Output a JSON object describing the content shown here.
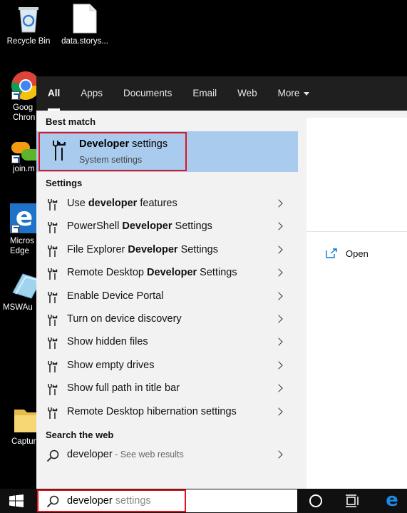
{
  "desktop": {
    "icons": [
      {
        "label": "Recycle Bin",
        "icon": "recycle-bin-icon"
      },
      {
        "label": "data.storys...",
        "icon": "file-icon"
      },
      {
        "label": "Goog Chron",
        "icon": "chrome-icon"
      },
      {
        "label": "join.m",
        "icon": "join-me-icon"
      },
      {
        "label": "Micros Edge",
        "icon": "edge-icon"
      },
      {
        "label": "MSWAu",
        "icon": "mswau-icon"
      },
      {
        "label": "Captur",
        "icon": "folder-icon"
      }
    ]
  },
  "tabs": [
    {
      "label": "All",
      "active": true
    },
    {
      "label": "Apps"
    },
    {
      "label": "Documents"
    },
    {
      "label": "Email"
    },
    {
      "label": "Web"
    },
    {
      "label": "More"
    }
  ],
  "best_match": {
    "heading": "Best match",
    "title_bold": "Developer",
    "title_rest": " settings",
    "subtitle": "System settings"
  },
  "settings": {
    "heading": "Settings",
    "items": [
      {
        "pre": "Use ",
        "bold": "developer",
        "post": " features"
      },
      {
        "pre": "PowerShell ",
        "bold": "Developer",
        "post": " Settings"
      },
      {
        "pre": "File Explorer ",
        "bold": "Developer",
        "post": " Settings"
      },
      {
        "pre": "Remote Desktop ",
        "bold": "Developer",
        "post": " Settings"
      },
      {
        "pre": "Enable Device Portal",
        "bold": "",
        "post": ""
      },
      {
        "pre": "Turn on device discovery",
        "bold": "",
        "post": ""
      },
      {
        "pre": "Show hidden files",
        "bold": "",
        "post": ""
      },
      {
        "pre": "Show empty drives",
        "bold": "",
        "post": ""
      },
      {
        "pre": "Show full path in title bar",
        "bold": "",
        "post": ""
      },
      {
        "pre": "Remote Desktop hibernation settings",
        "bold": "",
        "post": ""
      }
    ]
  },
  "web": {
    "heading": "Search the web",
    "query": "developer",
    "hint": " - See web results"
  },
  "preview": {
    "open_label": "Open"
  },
  "search": {
    "typed": "developer",
    "suggestion": " settings"
  },
  "colors": {
    "highlight": "#a9cbee",
    "outline": "#e0141e",
    "accent": "#0078d7"
  }
}
